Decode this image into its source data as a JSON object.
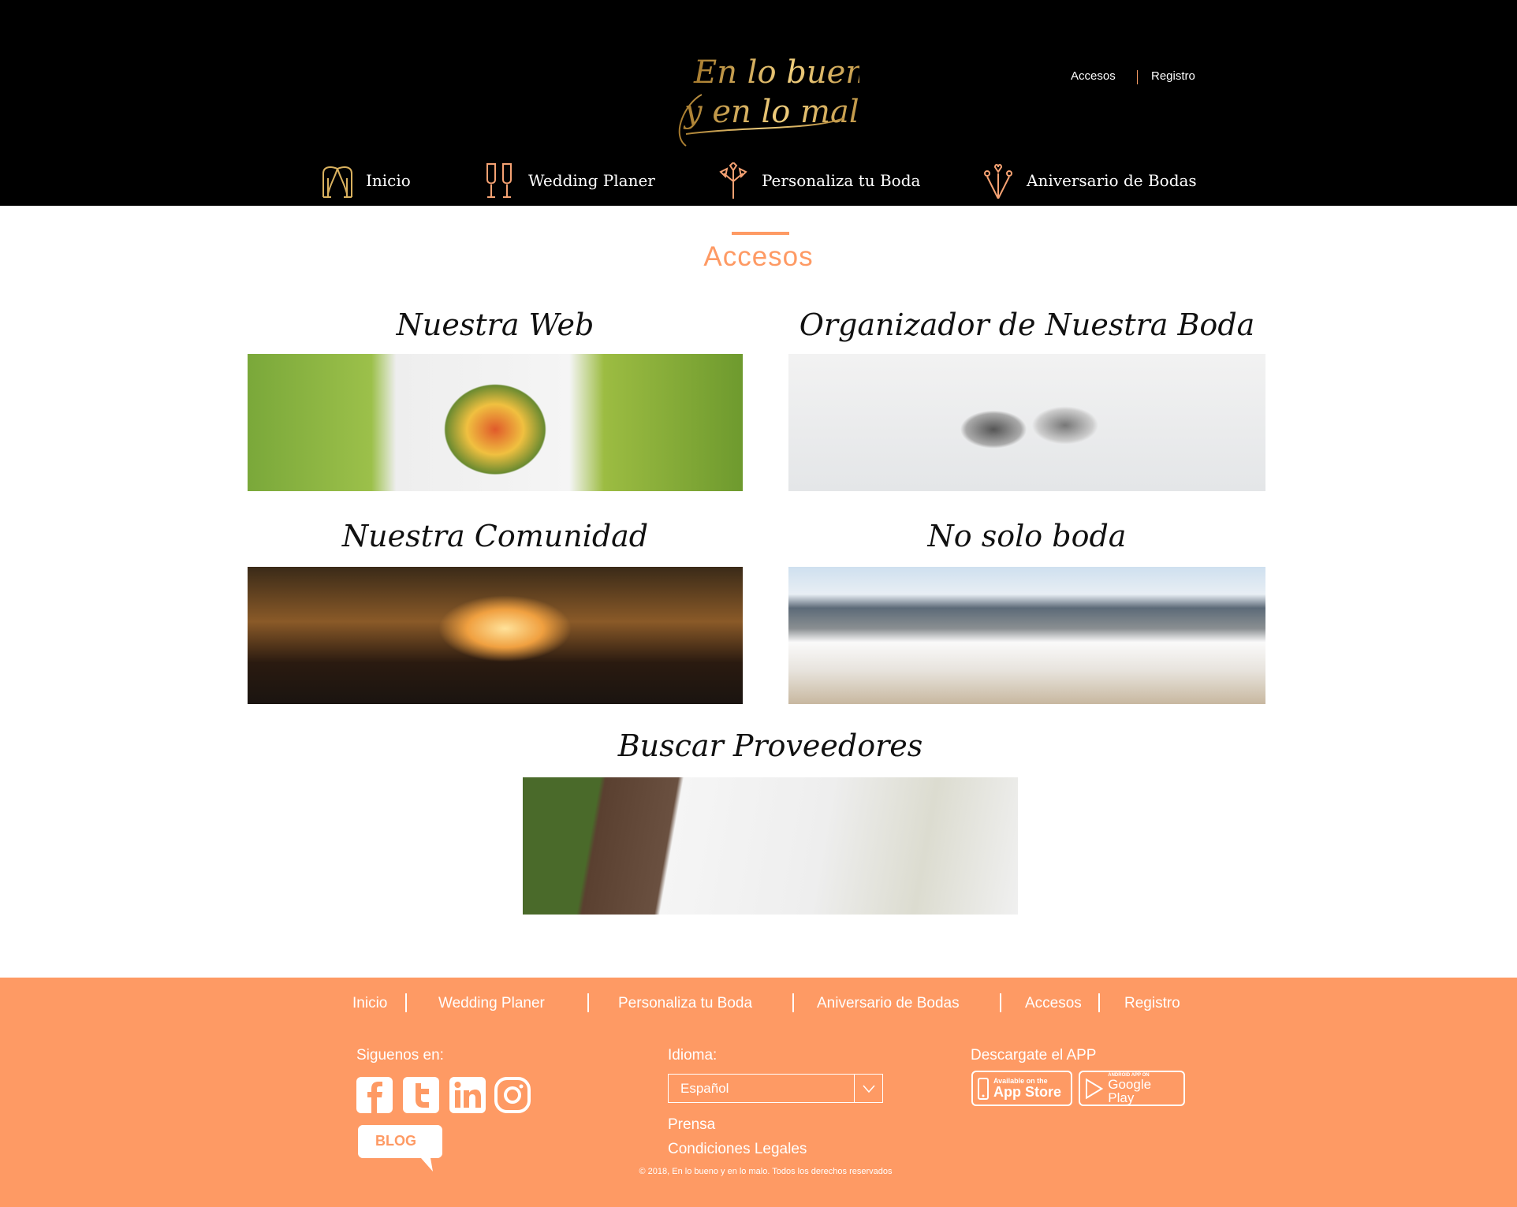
{
  "header": {
    "logo_text": "En lo bueno y en lo malo",
    "top_links": [
      "Accesos",
      "Registro"
    ],
    "nav": [
      {
        "label": "Inicio",
        "icon": "arch-icon"
      },
      {
        "label": "Wedding Planer",
        "icon": "champagne-glasses-icon"
      },
      {
        "label": "Personaliza tu Boda",
        "icon": "bouquet-icon"
      },
      {
        "label": "Aniversario de Bodas",
        "icon": "fireworks-icon"
      }
    ]
  },
  "main": {
    "title": "Accesos",
    "cards": [
      {
        "title": "Nuestra Web"
      },
      {
        "title": "Organizador de Nuestra Boda"
      },
      {
        "title": "Nuestra Comunidad"
      },
      {
        "title": "No solo boda"
      },
      {
        "title": "Buscar Proveedores"
      }
    ]
  },
  "footer": {
    "nav": [
      "Inicio",
      "Wedding Planer",
      "Personaliza tu Boda",
      "Aniversario de Bodas",
      "Accesos",
      "Registro"
    ],
    "social_label": "Siguenos en:",
    "blog_label": "BLOG",
    "language_label": "Idioma:",
    "language_value": "Español",
    "links": [
      "Prensa",
      "Condiciones Legales"
    ],
    "app_label": "Descargate el APP",
    "appstore": {
      "small": "Available on the",
      "big": "App Store"
    },
    "googleplay": {
      "small": "ANDROID APP ON",
      "big": "Google Play"
    },
    "copyright": "© 2018, En lo bueno y en lo malo. Todos los derechos reservados"
  },
  "colors": {
    "accent": "#fe9a64",
    "gold": "#c9a14a",
    "header_bg": "#000000"
  }
}
